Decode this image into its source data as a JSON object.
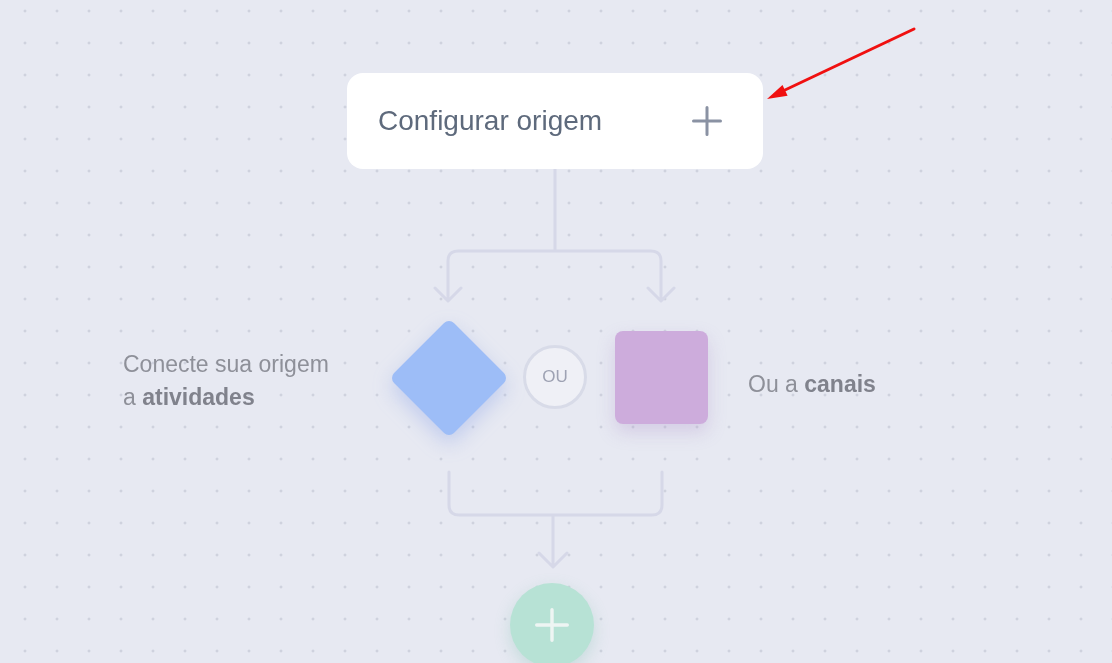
{
  "source_node": {
    "label": "Configurar origem"
  },
  "branches": [
    {
      "kind": "diamond",
      "color": "#9dbdf7",
      "caption": "Conecte sua origem\na **atividades**"
    },
    {
      "kind": "square",
      "color": "#cdacdc",
      "caption": "Ou a **canais**"
    }
  ],
  "separator": {
    "label": "OU"
  }
}
